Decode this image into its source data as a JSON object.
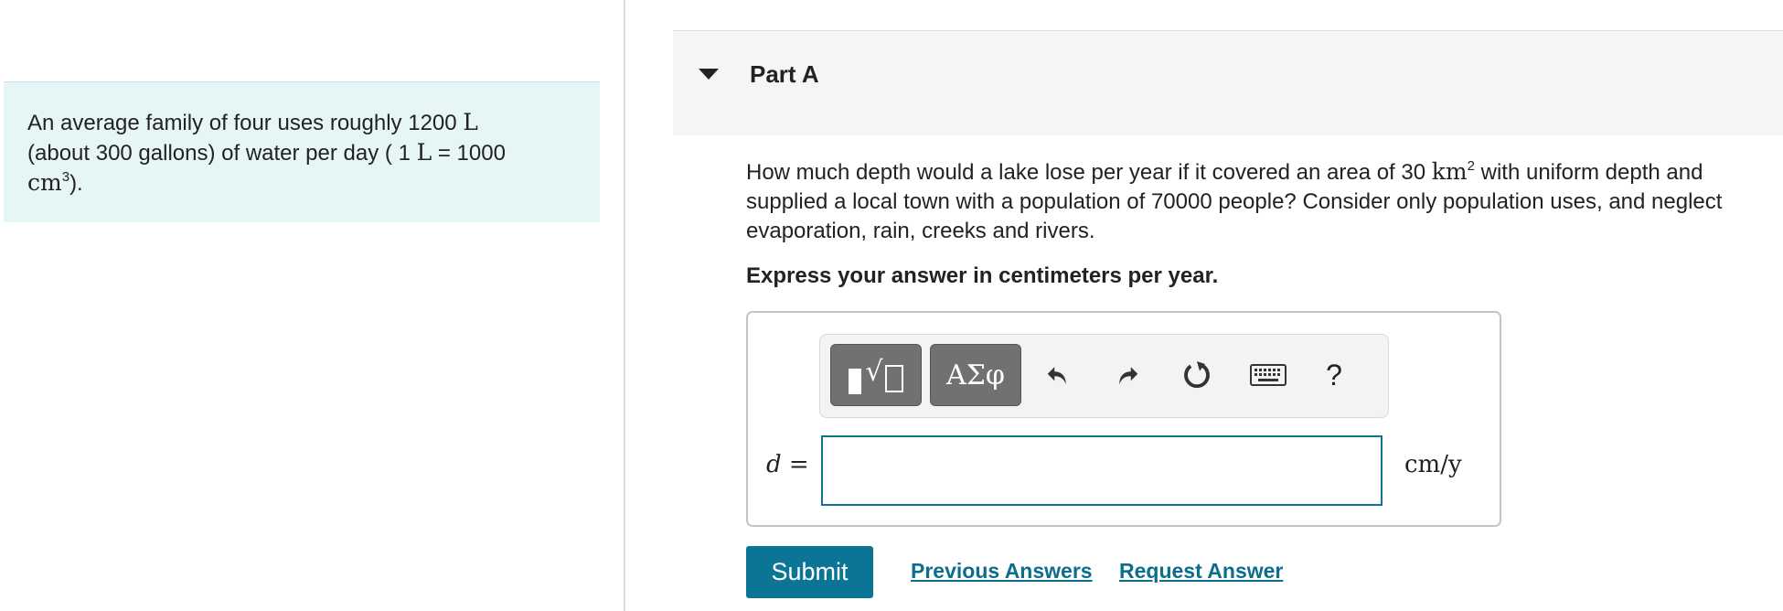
{
  "intro": {
    "t1": "An average family of four uses roughly 1200 ",
    "u1": "L",
    "t2": "(about 300 gallons) of water per day ( 1 ",
    "u2": "L",
    "t3": " = 1000",
    "u3": "cm",
    "sup": "3",
    "t4": ")."
  },
  "part": {
    "title": "Part A"
  },
  "question": {
    "t1": "How much depth would a lake lose per year if it covered an area of 30 ",
    "unit": "km",
    "sup": "2",
    "t2": " with uniform depth and supplied a local town with a population of 70000 people? Consider only population uses, and neglect evaporation, rain, creeks and rivers."
  },
  "instruction": "Express your answer in centimeters per year.",
  "toolbar": {
    "greek_label": "ΑΣφ",
    "radical_glyph": "√",
    "help_label": "?",
    "icons": [
      "templates-icon",
      "greek-letters-icon",
      "undo-icon",
      "redo-icon",
      "reset-icon",
      "keyboard-icon",
      "help-icon"
    ]
  },
  "answer": {
    "variable": "d",
    "equals": " =",
    "value": "",
    "units": "cm/y"
  },
  "actions": {
    "submit": "Submit",
    "previous": "Previous Answers",
    "request": "Request Answer"
  },
  "colors": {
    "accent": "#0b7596",
    "intro_bg": "#e6f6f6",
    "header_bg": "#f5f5f5",
    "toolbar_button": "#717171"
  }
}
